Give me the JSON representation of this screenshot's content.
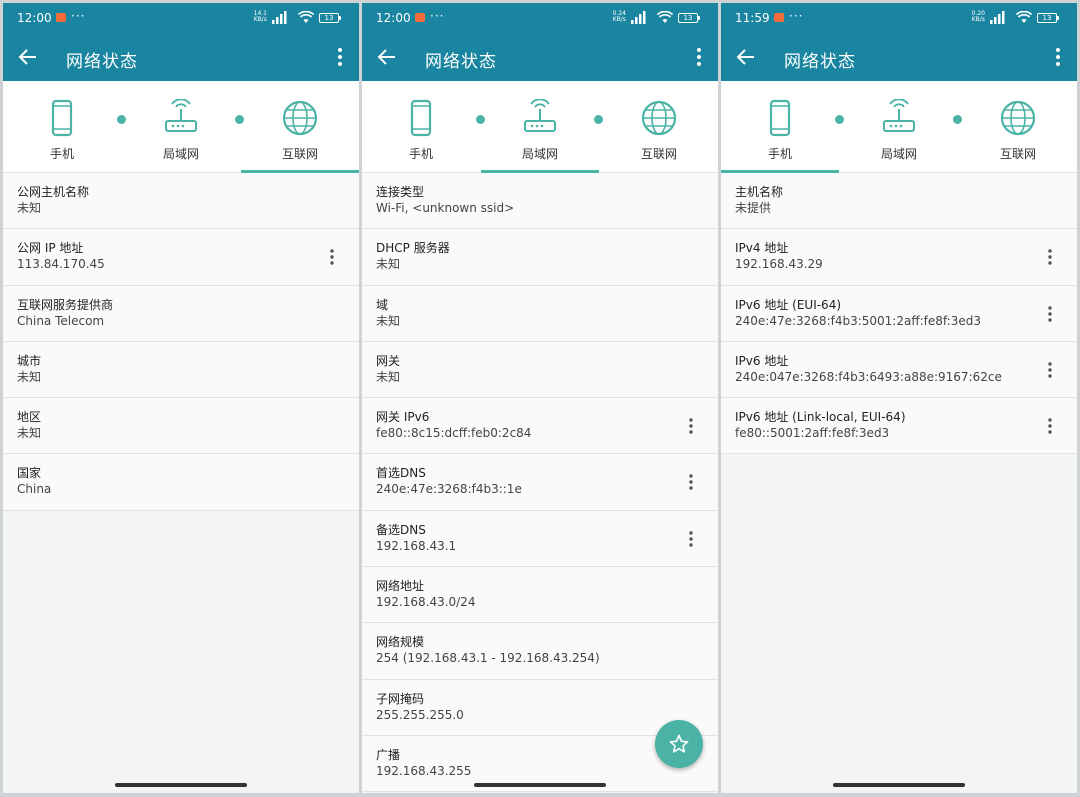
{
  "colors": {
    "accent": "#1a85a0",
    "teal": "#4ab3a5"
  },
  "screens": [
    {
      "status": {
        "time": "12:00",
        "speed_top": "14.1",
        "speed_bottom": "KB/s",
        "battery": "13"
      },
      "title": "网络状态",
      "tabs": [
        "手机",
        "局域网",
        "互联网"
      ],
      "active_tab": "互联网",
      "rows": [
        {
          "k": "公网主机名称",
          "v": "未知",
          "more": false
        },
        {
          "k": "公网 IP 地址",
          "v": "113.84.170.45",
          "more": true
        },
        {
          "k": "互联网服务提供商",
          "v": "China Telecom",
          "more": false
        },
        {
          "k": "城市",
          "v": "未知",
          "more": false
        },
        {
          "k": "地区",
          "v": "未知",
          "more": false
        },
        {
          "k": "国家",
          "v": "China",
          "more": false
        }
      ]
    },
    {
      "status": {
        "time": "12:00",
        "speed_top": "0.24",
        "speed_bottom": "KB/s",
        "battery": "13"
      },
      "title": "网络状态",
      "tabs": [
        "手机",
        "局域网",
        "互联网"
      ],
      "active_tab": "局域网",
      "rows": [
        {
          "k": "连接类型",
          "v": "Wi-Fi, <unknown ssid>",
          "more": false
        },
        {
          "k": "DHCP 服务器",
          "v": "未知",
          "more": false
        },
        {
          "k": "域",
          "v": "未知",
          "more": false
        },
        {
          "k": "网关",
          "v": "未知",
          "more": false
        },
        {
          "k": "网关 IPv6",
          "v": "fe80::8c15:dcff:feb0:2c84",
          "more": true
        },
        {
          "k": "首选DNS",
          "v": "240e:47e:3268:f4b3::1e",
          "more": true
        },
        {
          "k": "备选DNS",
          "v": "192.168.43.1",
          "more": true
        },
        {
          "k": "网络地址",
          "v": "192.168.43.0/24",
          "more": false
        },
        {
          "k": "网络规模",
          "v": "254 (192.168.43.1 - 192.168.43.254)",
          "more": false
        },
        {
          "k": "子网掩码",
          "v": "255.255.255.0",
          "more": false
        },
        {
          "k": "广播",
          "v": "192.168.43.255",
          "more": false
        }
      ]
    },
    {
      "status": {
        "time": "11:59",
        "speed_top": "0.20",
        "speed_bottom": "KB/s",
        "battery": "13"
      },
      "title": "网络状态",
      "tabs": [
        "手机",
        "局域网",
        "互联网"
      ],
      "active_tab": "手机",
      "rows": [
        {
          "k": "主机名称",
          "v": "未提供",
          "more": false
        },
        {
          "k": "IPv4 地址",
          "v": "192.168.43.29",
          "more": true
        },
        {
          "k": "IPv6 地址 (EUI-64)",
          "v": "240e:47e:3268:f4b3:5001:2aff:fe8f:3ed3",
          "more": true
        },
        {
          "k": "IPv6 地址",
          "v": "240e:047e:3268:f4b3:6493:a88e:9167:62ce",
          "more": true
        },
        {
          "k": "IPv6 地址 (Link-local, EUI-64)",
          "v": "fe80::5001:2aff:fe8f:3ed3",
          "more": true
        }
      ]
    }
  ]
}
